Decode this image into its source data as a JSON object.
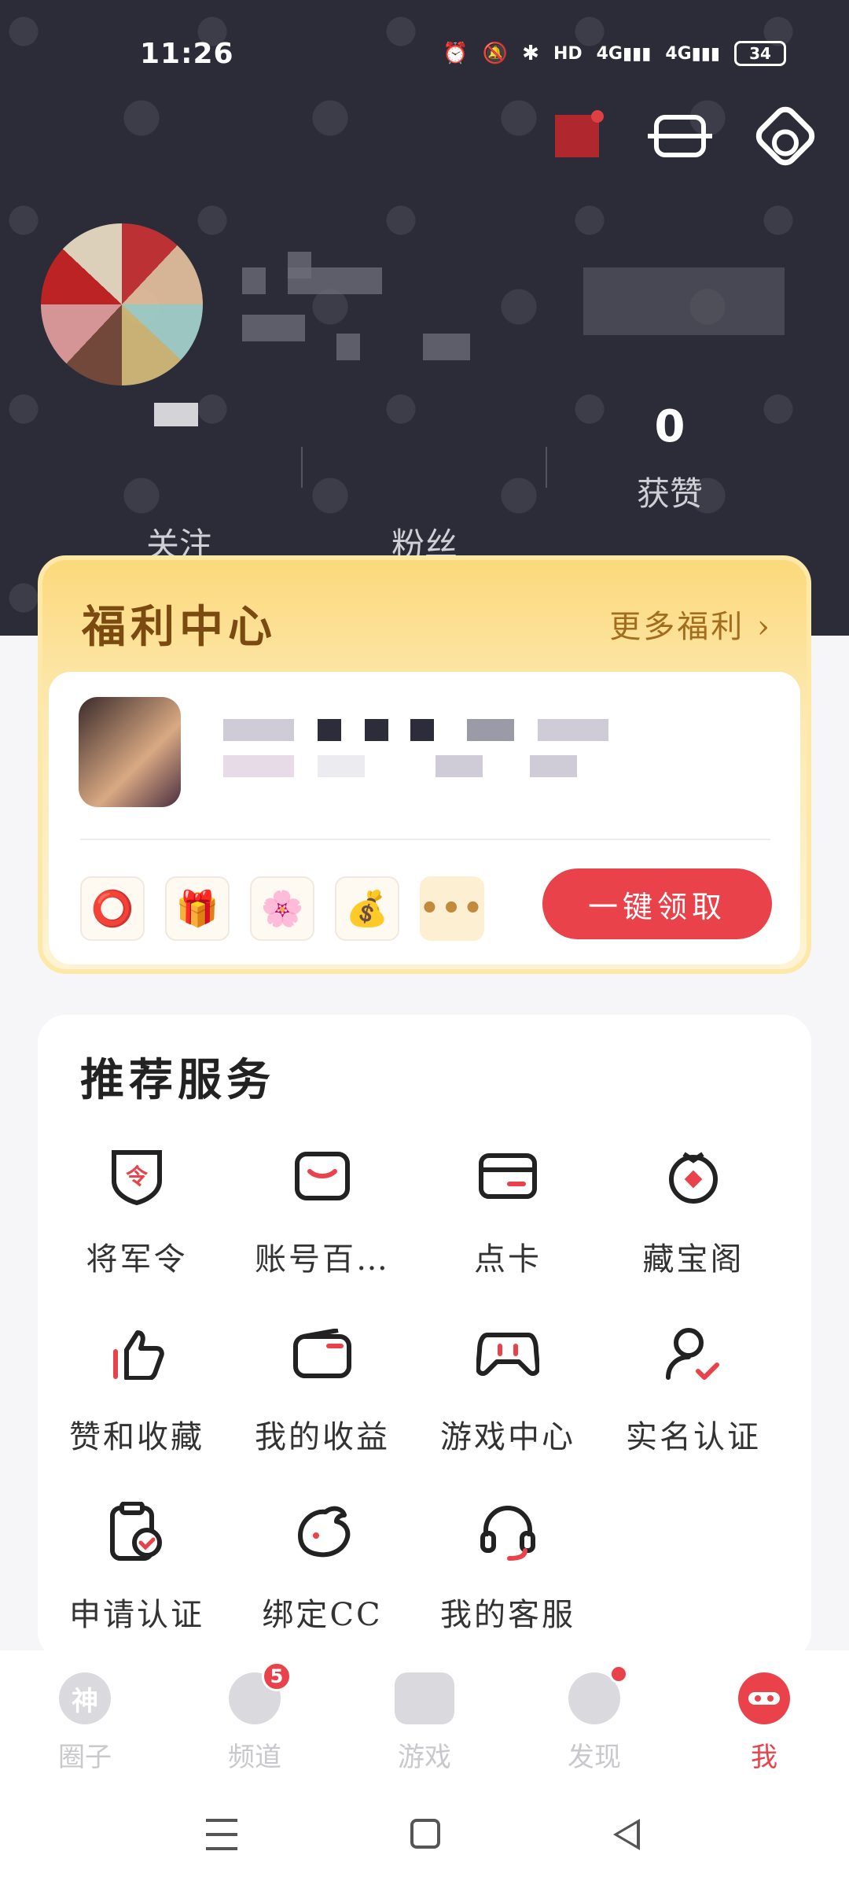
{
  "statusbar": {
    "time": "11:26",
    "battery": "34",
    "icons": [
      "alarm-icon",
      "mute-icon",
      "bluetooth-icon",
      "hd-icon",
      "signal-icon",
      "signal-icon"
    ]
  },
  "header": {
    "actions": [
      "notification-icon",
      "scan-icon",
      "settings-icon"
    ]
  },
  "stats": {
    "likes_count": "0",
    "follow_label": "关注",
    "fans_label": "粉丝",
    "likes_label": "获赞"
  },
  "welfare": {
    "title": "福利中心",
    "more_label": "更多福利 ›",
    "claim_label": "一键领取",
    "more_rewards": "•••"
  },
  "services": {
    "title": "推荐服务",
    "items": [
      {
        "label": "将军令",
        "icon": "shield-token-icon"
      },
      {
        "label": "账号百…",
        "icon": "account-icon"
      },
      {
        "label": "点卡",
        "icon": "card-icon"
      },
      {
        "label": "藏宝阁",
        "icon": "treasure-icon"
      },
      {
        "label": "赞和收藏",
        "icon": "thumbs-up-icon"
      },
      {
        "label": "我的收益",
        "icon": "wallet-icon"
      },
      {
        "label": "游戏中心",
        "icon": "gamepad-icon"
      },
      {
        "label": "实名认证",
        "icon": "verified-user-icon"
      },
      {
        "label": "申请认证",
        "icon": "apply-cert-icon"
      },
      {
        "label": "绑定CC",
        "icon": "cc-icon"
      },
      {
        "label": "我的客服",
        "icon": "headset-icon"
      }
    ]
  },
  "nav": {
    "items": [
      {
        "label": "圈子",
        "glyph": "神"
      },
      {
        "label": "频道",
        "glyph": "",
        "badge": "5"
      },
      {
        "label": "游戏",
        "glyph": ""
      },
      {
        "label": "发现",
        "glyph": ""
      },
      {
        "label": "我",
        "glyph": ""
      }
    ]
  },
  "colors": {
    "header_bg": "#2b2c38",
    "accent": "#e9424a",
    "welfare_gold": "#fbd97c"
  }
}
